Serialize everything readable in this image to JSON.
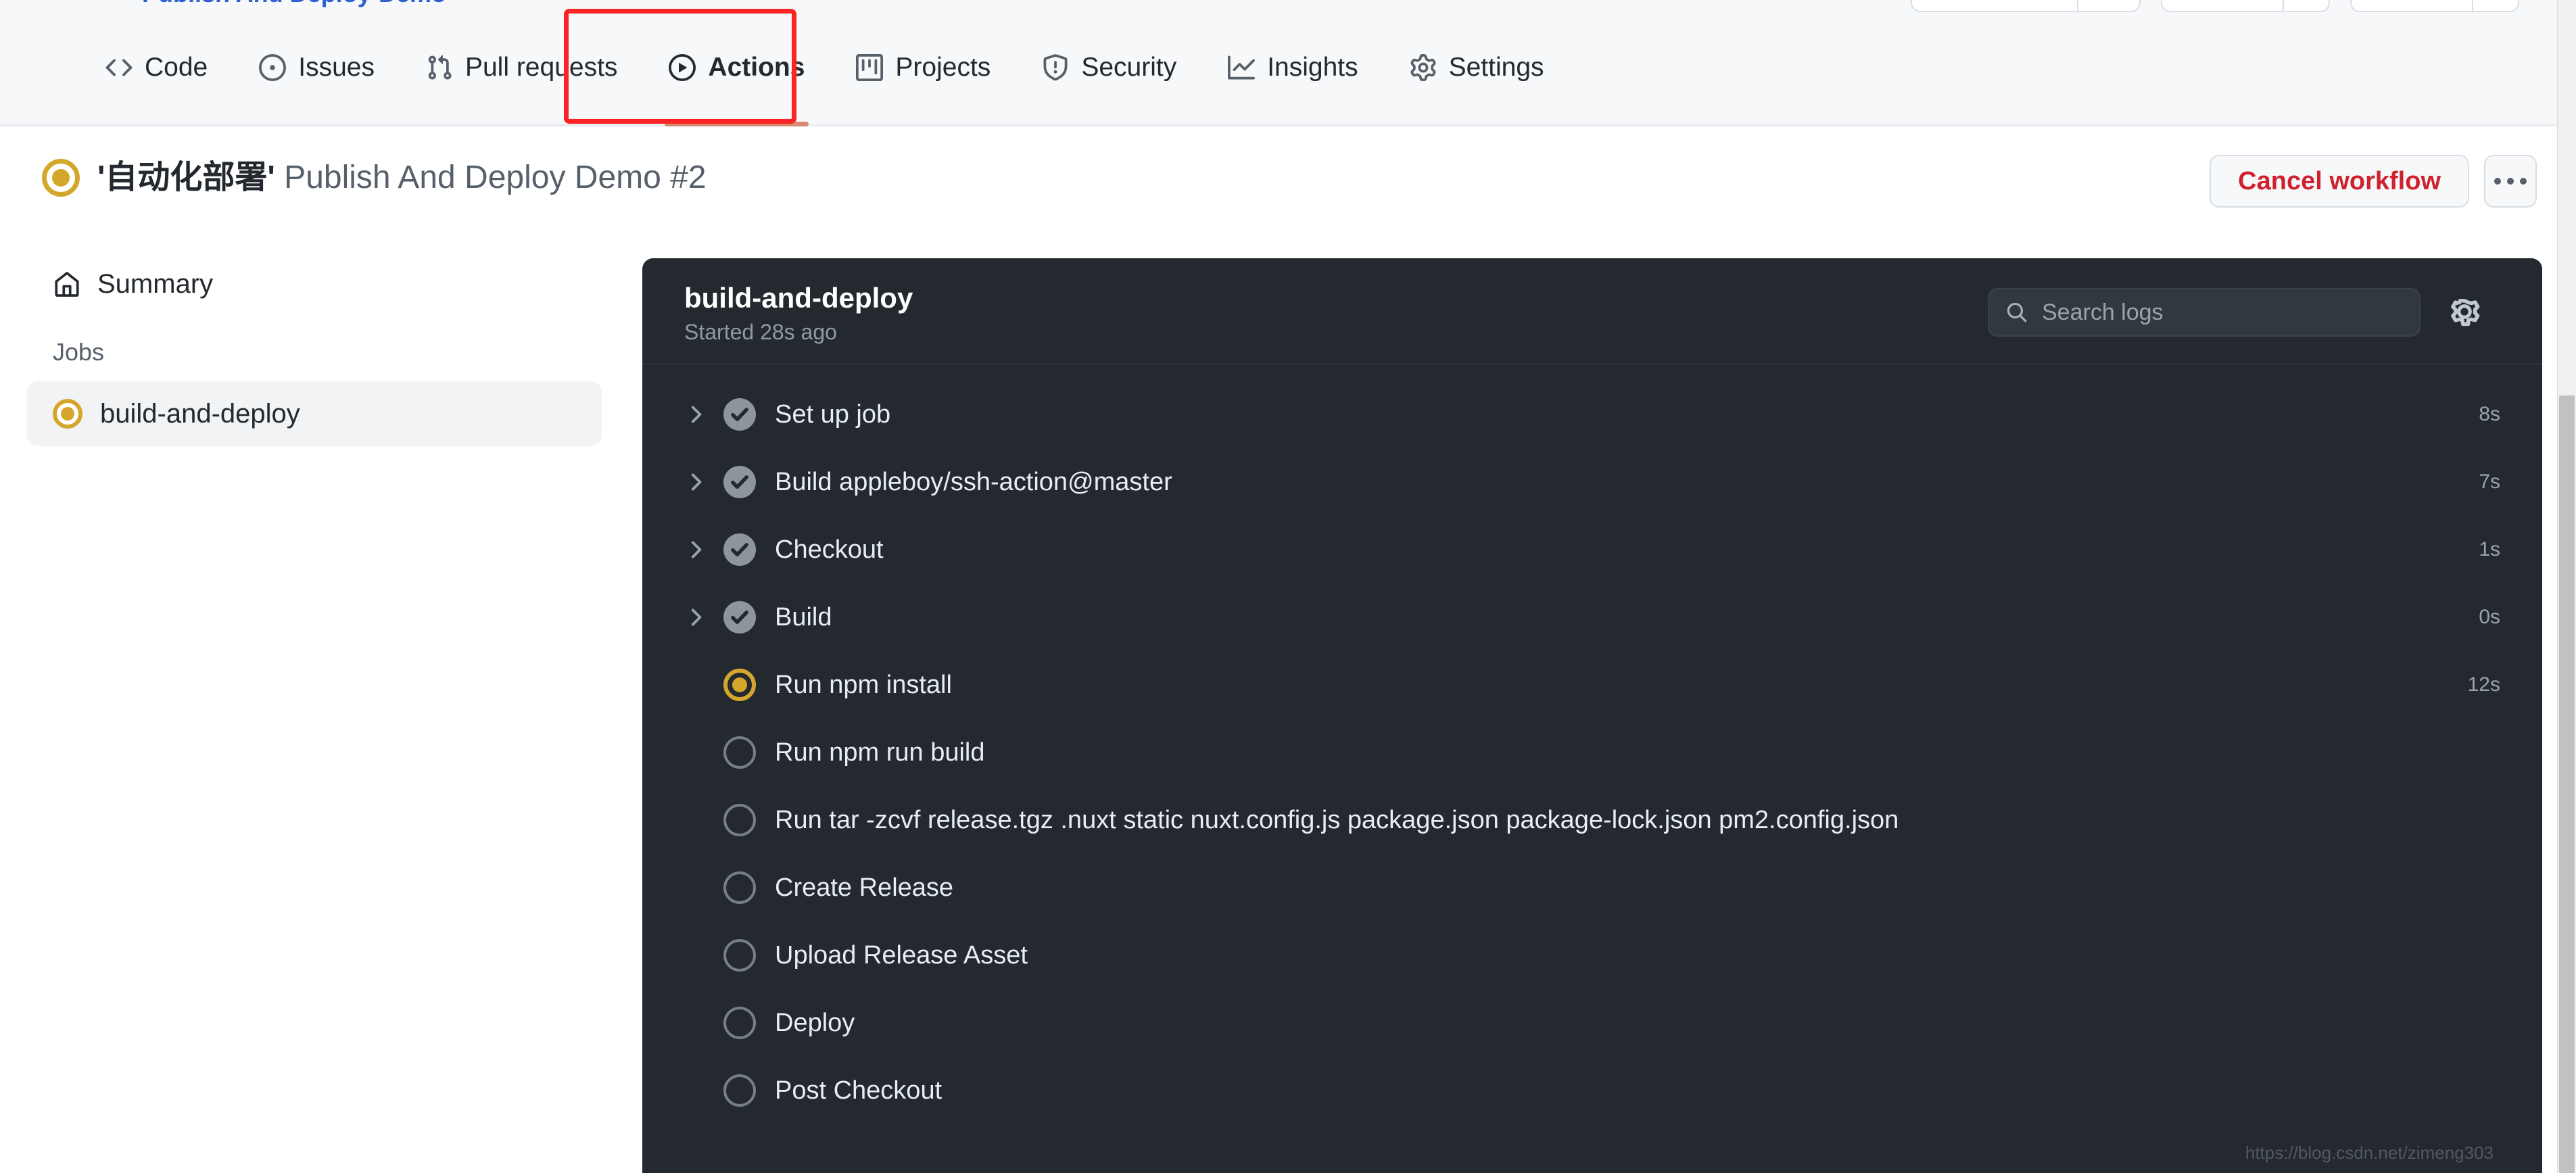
{
  "top_strip": {
    "cut_text_fragments": [
      "Publish And Deploy",
      "Demo"
    ],
    "split_buttons": 3
  },
  "repo_nav": {
    "tabs": [
      {
        "label": "Code",
        "icon": "code-icon",
        "active": false
      },
      {
        "label": "Issues",
        "icon": "issue-icon",
        "active": false
      },
      {
        "label": "Pull requests",
        "icon": "pr-icon",
        "active": false
      },
      {
        "label": "Actions",
        "icon": "play-icon",
        "active": true
      },
      {
        "label": "Projects",
        "icon": "project-icon",
        "active": false
      },
      {
        "label": "Security",
        "icon": "shield-icon",
        "active": false
      },
      {
        "label": "Insights",
        "icon": "graph-icon",
        "active": false
      },
      {
        "label": "Settings",
        "icon": "gear-icon",
        "active": false
      }
    ],
    "annotation_color": "#fb2323",
    "active_underline_color": "#d98b72"
  },
  "page_header": {
    "status_icon": "in-progress-icon",
    "status_color": "#d4a72c",
    "workflow_name": "'自动化部署'",
    "run_title": " Publish And Deploy Demo #2",
    "cancel_label": "Cancel workflow",
    "cancel_color": "#cf222e",
    "kebab_label": "..."
  },
  "sidebar": {
    "summary_label": "Summary",
    "summary_icon": "home-icon",
    "jobs_heading": "Jobs",
    "jobs": [
      {
        "label": "build-and-deploy",
        "status": "in_progress",
        "selected": true
      }
    ]
  },
  "log_panel": {
    "job_title": "build-and-deploy",
    "started_text": "Started 28s ago",
    "search": {
      "placeholder": "Search logs",
      "value": "",
      "icon": "search-icon"
    },
    "settings_icon": "gear-icon",
    "steps": [
      {
        "label": "Set up job",
        "status": "success",
        "duration": "8s",
        "expandable": true
      },
      {
        "label": "Build appleboy/ssh-action@master",
        "status": "success",
        "duration": "7s",
        "expandable": true
      },
      {
        "label": "Checkout",
        "status": "success",
        "duration": "1s",
        "expandable": true
      },
      {
        "label": "Build",
        "status": "success",
        "duration": "0s",
        "expandable": true
      },
      {
        "label": "Run npm install",
        "status": "in_progress",
        "duration": "12s",
        "expandable": false
      },
      {
        "label": "Run npm run build",
        "status": "pending",
        "duration": "",
        "expandable": false
      },
      {
        "label": "Run tar -zcvf release.tgz .nuxt static nuxt.config.js package.json package-lock.json pm2.config.json",
        "status": "pending",
        "duration": "",
        "expandable": false
      },
      {
        "label": "Create Release",
        "status": "pending",
        "duration": "",
        "expandable": false
      },
      {
        "label": "Upload Release Asset",
        "status": "pending",
        "duration": "",
        "expandable": false
      },
      {
        "label": "Deploy",
        "status": "pending",
        "duration": "",
        "expandable": false
      },
      {
        "label": "Post Checkout",
        "status": "pending",
        "duration": "",
        "expandable": false
      }
    ]
  },
  "watermark": "https://blog.csdn.net/zimeng303"
}
